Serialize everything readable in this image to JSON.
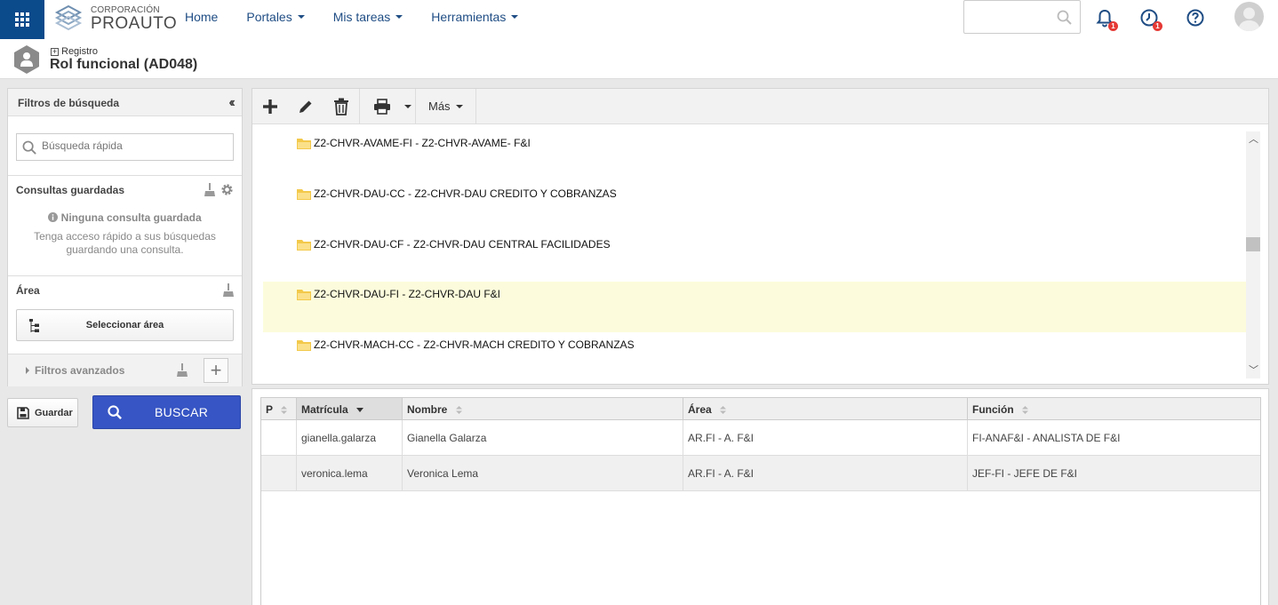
{
  "brand": {
    "line1": "CORPORACIÓN",
    "line2": "PROAUTO"
  },
  "nav": {
    "home": "Home",
    "portales": "Portales",
    "tareas": "Mis tareas",
    "herramientas": "Herramientas"
  },
  "notifications": {
    "bell_count": "1",
    "clock_count": "1"
  },
  "page": {
    "breadcrumb": "Registro",
    "title": "Rol funcional (AD048)"
  },
  "filters": {
    "title": "Filtros de búsqueda",
    "quick_search_placeholder": "Búsqueda rápida",
    "saved_title": "Consultas guardadas",
    "none_saved": "Ninguna consulta guardada",
    "none_saved_help": "Tenga acceso rápido a sus búsquedas guardando una consulta.",
    "area_title": "Área",
    "select_area": "Seleccionar área",
    "advanced": "Filtros avanzados",
    "save_label": "Guardar",
    "search_label": "BUSCAR"
  },
  "toolbar": {
    "more_label": "Más"
  },
  "tree": {
    "items": [
      {
        "label": "Z2-CHVR-AVAME-FI - Z2-CHVR-AVAME- F&I",
        "selected": false
      },
      {
        "label": "Z2-CHVR-DAU-CC - Z2-CHVR-DAU CREDITO Y COBRANZAS",
        "selected": false
      },
      {
        "label": "Z2-CHVR-DAU-CF - Z2-CHVR-DAU CENTRAL FACILIDADES",
        "selected": false
      },
      {
        "label": "Z2-CHVR-DAU-FI - Z2-CHVR-DAU F&I",
        "selected": true
      },
      {
        "label": "Z2-CHVR-MACH-CC - Z2-CHVR-MACH CREDITO Y COBRANZAS",
        "selected": false
      }
    ]
  },
  "grid": {
    "columns": [
      "P",
      "Matrícula",
      "Nombre",
      "Área",
      "Función"
    ],
    "rows": [
      {
        "p": "",
        "matricula": "gianella.galarza",
        "nombre": "Gianella Galarza",
        "area": "AR.FI - A. F&I",
        "funcion": "FI-ANAF&I - ANALISTA DE F&I"
      },
      {
        "p": "",
        "matricula": "veronica.lema",
        "nombre": "Veronica Lema",
        "area": "AR.FI - A. F&I",
        "funcion": "JEF-FI - JEFE DE F&I"
      }
    ]
  },
  "colors": {
    "primary": "#3755c4",
    "apps_bg": "#0b4a8b",
    "nav_link": "#1f4d84",
    "selected_row": "#fcfcdc"
  }
}
